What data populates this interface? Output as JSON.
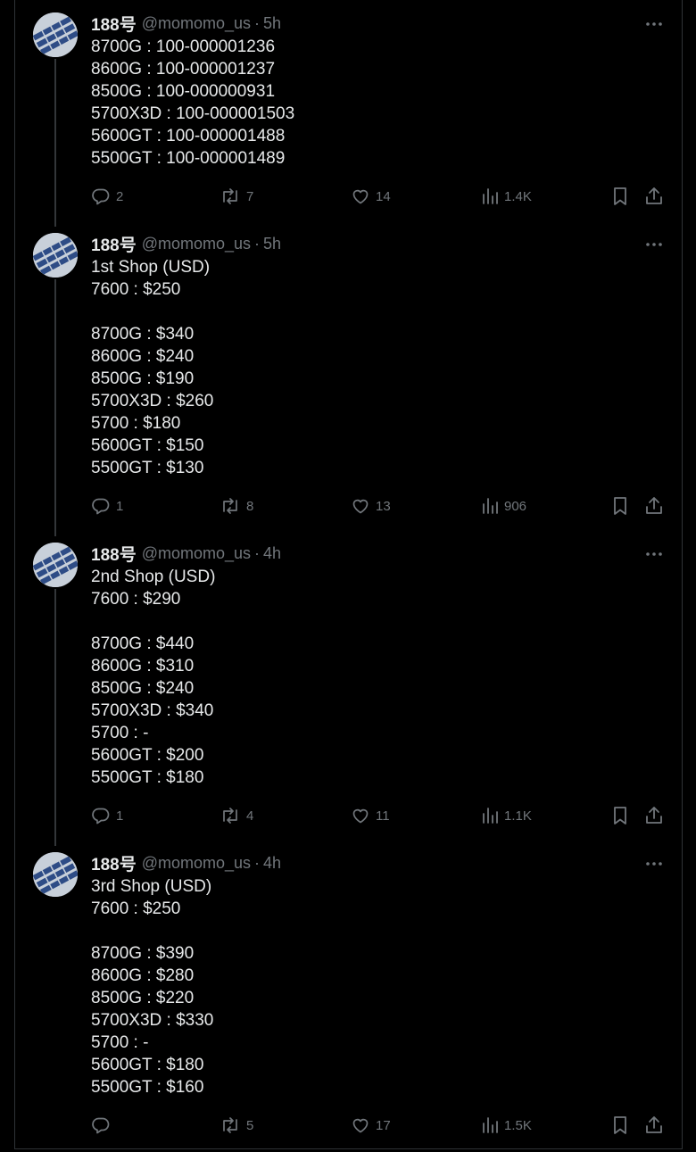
{
  "theme": {
    "background": "#000000",
    "text": "#e7e9ea",
    "muted": "#71767b",
    "border": "#2f3336"
  },
  "tweets": [
    {
      "name": "188号",
      "handle": "@momomo_us",
      "separator": "·",
      "time": "5h",
      "lines": [
        "8700G : 100-000001236",
        "8600G : 100-000001237",
        "8500G : 100-000000931",
        "5700X3D : 100-000001503",
        "5600GT : 100-000001488",
        "5500GT : 100-000001489"
      ],
      "replies": "2",
      "reposts": "7",
      "likes": "14",
      "views": "1.4K"
    },
    {
      "name": "188号",
      "handle": "@momomo_us",
      "separator": "·",
      "time": "5h",
      "lines": [
        "1st Shop (USD)",
        "7600 : $250",
        "",
        "8700G : $340",
        "8600G : $240",
        "8500G : $190",
        "5700X3D : $260",
        "5700 : $180",
        "5600GT : $150",
        "5500GT : $130"
      ],
      "replies": "1",
      "reposts": "8",
      "likes": "13",
      "views": "906"
    },
    {
      "name": "188号",
      "handle": "@momomo_us",
      "separator": "·",
      "time": "4h",
      "lines": [
        "2nd Shop (USD)",
        "7600 : $290",
        "",
        "8700G : $440",
        "8600G : $310",
        "8500G : $240",
        "5700X3D : $340",
        "5700 : -",
        "5600GT : $200",
        "5500GT : $180"
      ],
      "replies": "1",
      "reposts": "4",
      "likes": "11",
      "views": "1.1K"
    },
    {
      "name": "188号",
      "handle": "@momomo_us",
      "separator": "·",
      "time": "4h",
      "lines": [
        "3rd Shop (USD)",
        "7600 : $250",
        "",
        "8700G : $390",
        "8600G : $280",
        "8500G : $220",
        "5700X3D : $330",
        "5700 : -",
        "5600GT : $180",
        "5500GT : $160"
      ],
      "replies": "",
      "reposts": "5",
      "likes": "17",
      "views": "1.5K"
    }
  ],
  "icons": {
    "avatar": "avatar-image",
    "more": "more-icon",
    "reply": "reply-icon",
    "repost": "repost-icon",
    "like": "like-icon",
    "views": "views-icon",
    "bookmark": "bookmark-icon",
    "share": "share-icon"
  }
}
